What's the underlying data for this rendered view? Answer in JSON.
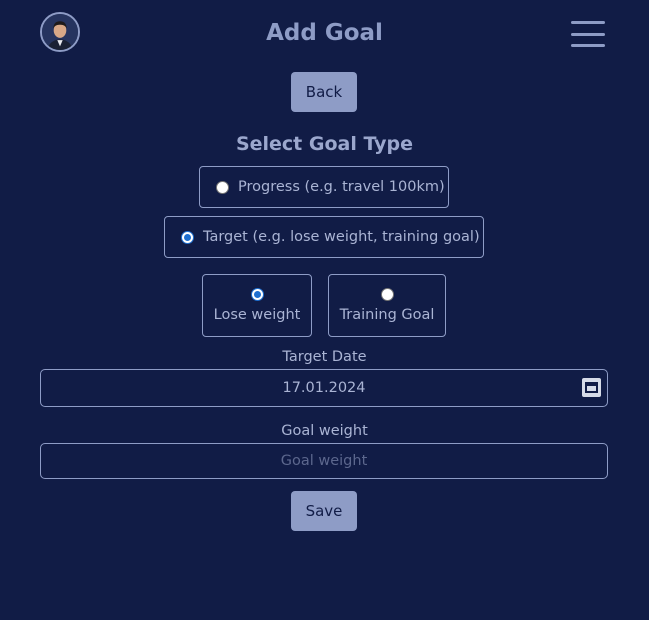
{
  "header": {
    "title": "Add Goal"
  },
  "buttons": {
    "back_label": "Back",
    "save_label": "Save"
  },
  "goal_type": {
    "heading": "Select Goal Type",
    "options": [
      {
        "label": "Progress (e.g. travel 100km)",
        "checked": false
      },
      {
        "label": "Target (e.g. lose weight, training goal)",
        "checked": true
      }
    ],
    "target_options": [
      {
        "label": "Lose weight",
        "checked": true
      },
      {
        "label": "Training Goal",
        "checked": false
      }
    ]
  },
  "fields": {
    "target_date_label": "Target Date",
    "target_date_value": "17.01.2024",
    "goal_weight_label": "Goal weight",
    "goal_weight_placeholder": "Goal weight",
    "goal_weight_value": ""
  },
  "icons": {
    "avatar": "avatar-photo",
    "menu": "hamburger-menu-icon",
    "calendar": "calendar-icon"
  },
  "colors": {
    "background": "#111c46",
    "accent": "#8e9cc6",
    "radio_checked": "#1e6fd0"
  }
}
